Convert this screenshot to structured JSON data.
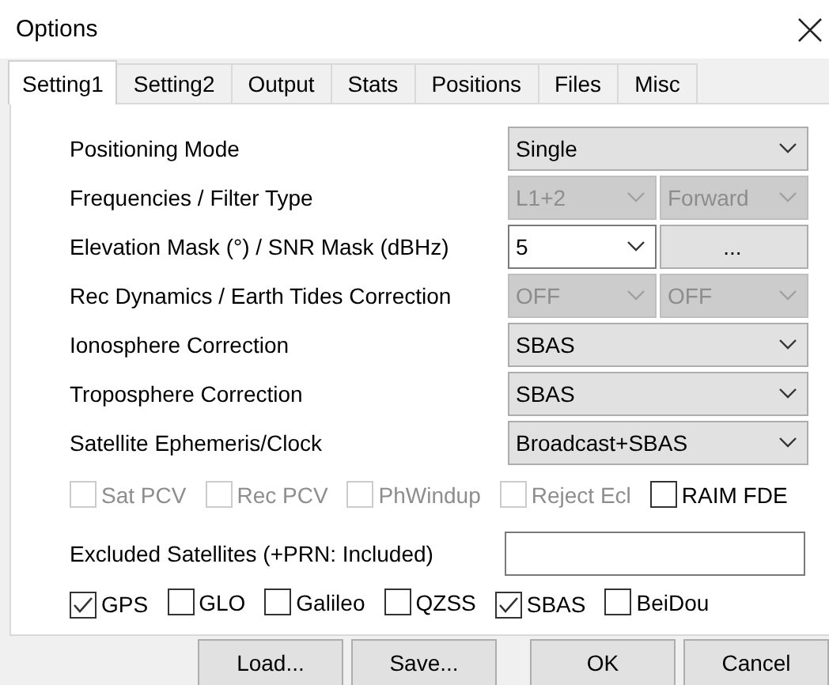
{
  "window": {
    "title": "Options"
  },
  "tabs": [
    {
      "label": "Setting1",
      "selected": true
    },
    {
      "label": "Setting2",
      "selected": false
    },
    {
      "label": "Output",
      "selected": false
    },
    {
      "label": "Stats",
      "selected": false
    },
    {
      "label": "Positions",
      "selected": false
    },
    {
      "label": "Files",
      "selected": false
    },
    {
      "label": "Misc",
      "selected": false
    }
  ],
  "rows": [
    {
      "label": "Positioning Mode",
      "controls": [
        {
          "kind": "combo",
          "value": "Single",
          "disabled": false,
          "editable": false
        }
      ]
    },
    {
      "label": "Frequencies / Filter Type",
      "controls": [
        {
          "kind": "combo",
          "value": "L1+2",
          "disabled": true,
          "editable": false
        },
        {
          "kind": "combo",
          "value": "Forward",
          "disabled": true,
          "editable": false
        }
      ]
    },
    {
      "label": "Elevation Mask (°) / SNR Mask (dBHz)",
      "controls": [
        {
          "kind": "combo",
          "value": "5",
          "disabled": false,
          "editable": true
        },
        {
          "kind": "button",
          "value": "..."
        }
      ]
    },
    {
      "label": "Rec Dynamics / Earth Tides Correction",
      "controls": [
        {
          "kind": "combo",
          "value": "OFF",
          "disabled": true,
          "editable": false
        },
        {
          "kind": "combo",
          "value": "OFF",
          "disabled": true,
          "editable": false
        }
      ]
    },
    {
      "label": "Ionosphere Correction",
      "controls": [
        {
          "kind": "combo",
          "value": "SBAS",
          "disabled": false,
          "editable": false
        }
      ]
    },
    {
      "label": "Troposphere Correction",
      "controls": [
        {
          "kind": "combo",
          "value": "SBAS",
          "disabled": false,
          "editable": false
        }
      ]
    },
    {
      "label": "Satellite Ephemeris/Clock",
      "controls": [
        {
          "kind": "combo",
          "value": "Broadcast+SBAS",
          "disabled": false,
          "editable": false
        }
      ]
    }
  ],
  "corrections": [
    {
      "label": "Sat PCV",
      "checked": false,
      "disabled": true
    },
    {
      "label": "Rec PCV",
      "checked": false,
      "disabled": true
    },
    {
      "label": "PhWindup",
      "checked": false,
      "disabled": true
    },
    {
      "label": "Reject Ecl",
      "checked": false,
      "disabled": true
    },
    {
      "label": "RAIM FDE",
      "checked": false,
      "disabled": false
    }
  ],
  "excluded": {
    "label": "Excluded Satellites (+PRN: Included)"
  },
  "systems": [
    {
      "label": "GPS",
      "checked": true,
      "disabled": false
    },
    {
      "label": "GLO",
      "checked": false,
      "disabled": false
    },
    {
      "label": "Galileo",
      "checked": false,
      "disabled": false
    },
    {
      "label": "QZSS",
      "checked": false,
      "disabled": false
    },
    {
      "label": "SBAS",
      "checked": true,
      "disabled": false
    },
    {
      "label": "BeiDou",
      "checked": false,
      "disabled": false
    }
  ],
  "buttons_left": [
    "Load...",
    "Save..."
  ],
  "buttons_right": [
    "OK",
    "Cancel"
  ]
}
